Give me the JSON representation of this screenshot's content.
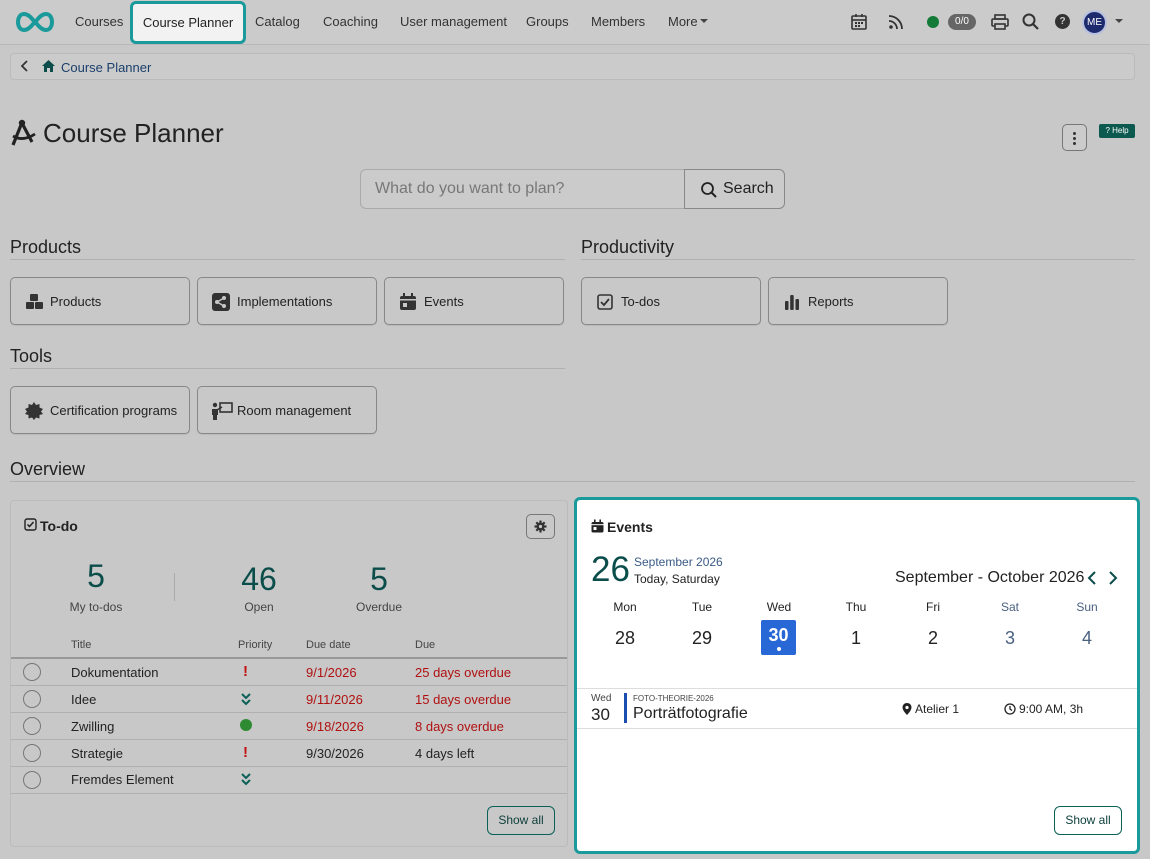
{
  "nav": {
    "items": [
      "Courses",
      "Course Planner",
      "Catalog",
      "Coaching",
      "User management",
      "Groups",
      "Members",
      "More"
    ],
    "badge": "0/0",
    "avatar": "ME"
  },
  "breadcrumb": {
    "label": "Course Planner"
  },
  "page": {
    "title": "Course Planner",
    "help": "Help"
  },
  "search": {
    "placeholder": "What do you want to plan?",
    "button": "Search"
  },
  "sections": {
    "products": {
      "title": "Products",
      "tiles": [
        "Products",
        "Implementations",
        "Events"
      ]
    },
    "productivity": {
      "title": "Productivity",
      "tiles": [
        "To-dos",
        "Reports"
      ]
    },
    "tools": {
      "title": "Tools",
      "tiles": [
        "Certification programs",
        "Room management"
      ]
    },
    "overview": {
      "title": "Overview"
    }
  },
  "todo": {
    "title": "To-do",
    "stats": [
      {
        "value": "5",
        "label": "My to-dos"
      },
      {
        "value": "46",
        "label": "Open"
      },
      {
        "value": "5",
        "label": "Overdue"
      }
    ],
    "columns": [
      "Title",
      "Priority",
      "Due date",
      "Due"
    ],
    "rows": [
      {
        "title": "Dokumentation",
        "priority": "high",
        "due_date": "9/1/2026",
        "due": "25 days overdue",
        "overdue": true
      },
      {
        "title": "Idee",
        "priority": "low",
        "due_date": "9/11/2026",
        "due": "15 days overdue",
        "overdue": true
      },
      {
        "title": "Zwilling",
        "priority": "medium",
        "due_date": "9/18/2026",
        "due": "8 days overdue",
        "overdue": true
      },
      {
        "title": "Strategie",
        "priority": "high",
        "due_date": "9/30/2026",
        "due": "4 days left",
        "overdue": false
      },
      {
        "title": "Fremdes Element",
        "priority": "low",
        "due_date": "",
        "due": "",
        "overdue": false
      }
    ],
    "show_all": "Show all"
  },
  "events": {
    "title": "Events",
    "today_num": "26",
    "today_month": "September 2026",
    "today_label": "Today, Saturday",
    "range": "September - October 2026",
    "weekdays": [
      "Mon",
      "Tue",
      "Wed",
      "Thu",
      "Fri",
      "Sat",
      "Sun"
    ],
    "days": [
      "28",
      "29",
      "30",
      "1",
      "2",
      "3",
      "4"
    ],
    "selected_index": 2,
    "event": {
      "weekday": "Wed",
      "day": "30",
      "code": "FOTO-THEORIE-2026",
      "title": "Porträtfotografie",
      "location": "Atelier 1",
      "time": "9:00 AM, 3h"
    },
    "show_all": "Show all"
  },
  "colors": {
    "accent": "#1a9a9a",
    "teal": "#0b4d4a",
    "overdue": "#b01010",
    "selected": "#2767d6"
  }
}
